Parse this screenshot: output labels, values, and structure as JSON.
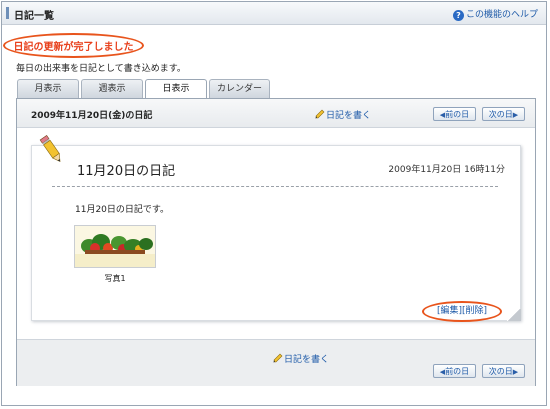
{
  "header": {
    "title": "日記一覧",
    "help_label": "この機能のヘルプ"
  },
  "notice": "日記の更新が完了しました",
  "description": "毎日の出来事を日記として書き込めます。",
  "tabs": [
    {
      "label": "月表示",
      "active": false
    },
    {
      "label": "週表示",
      "active": false
    },
    {
      "label": "日表示",
      "active": true
    },
    {
      "label": "カレンダー",
      "active": false
    }
  ],
  "panel": {
    "date_title": "2009年11月20日(金)の日記",
    "write_label": "日記を書く",
    "prev_label": "前の日",
    "next_label": "次の日"
  },
  "entry": {
    "title": "11月20日の日記",
    "datetime": "2009年11月20日 16時11分",
    "body": "11月20日の日記です。",
    "photo_caption": "写真1",
    "edit_label": "[編集]",
    "delete_label": "[削除]"
  },
  "footer": {
    "write_label": "日記を書く",
    "prev_label": "前の日",
    "next_label": "次の日"
  },
  "colors": {
    "accent": "#1e5aa8",
    "notice": "#e8401c",
    "highlight": "#e8541c"
  }
}
